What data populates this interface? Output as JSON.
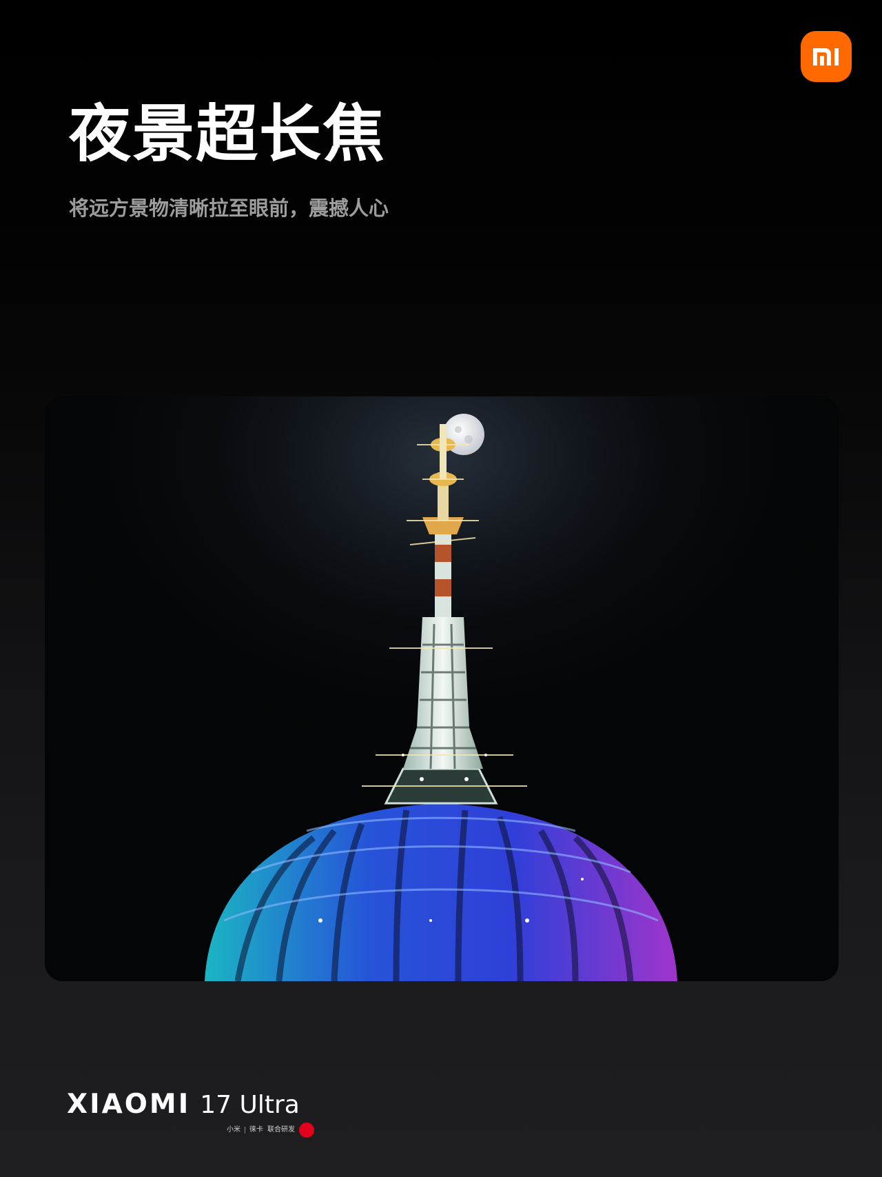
{
  "header": {
    "headline": "夜景超长焦",
    "subline": "将远方景物清晰拉至眼前，震撼人心"
  },
  "logo": {
    "text": "mi",
    "color": "#ff6900"
  },
  "photo": {
    "description_icon": "tv-tower-night-photo"
  },
  "brand": {
    "name": "XIAOMI",
    "model": "17 Ultra",
    "partner_1": "小米",
    "partner_2": "徕卡",
    "partner_3": "联合研发",
    "leica_color": "#e2001a"
  }
}
